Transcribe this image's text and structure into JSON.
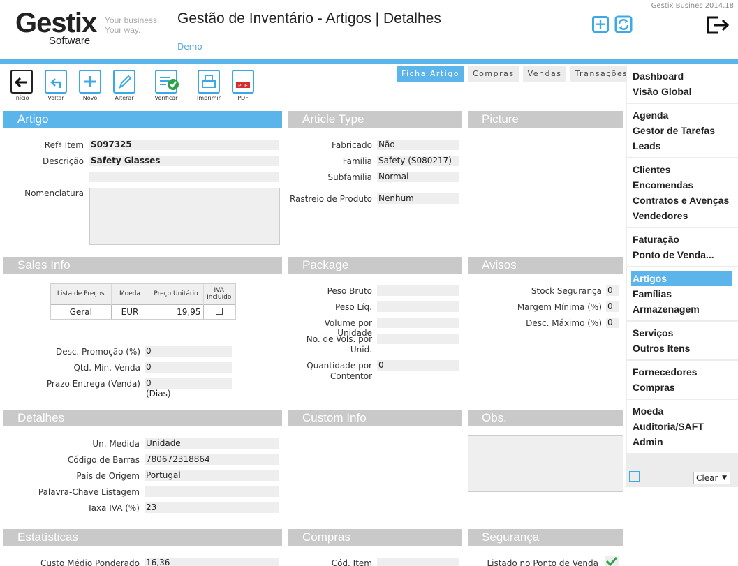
{
  "header": {
    "version": "Gestix Busines 2014.18",
    "logo_main": "Gestix",
    "logo_sub": "Software",
    "tagline_1": "Your business.",
    "tagline_2": "Your way.",
    "page_title": "Gestão de Inventário - Artigos | Detalhes",
    "company": "Demo"
  },
  "toolbar": {
    "inicio": "Início",
    "voltar": "Voltar",
    "novo": "Novo",
    "alterar": "Alterar",
    "verificar": "Verificar",
    "imprimir": "Imprimir",
    "pdf": "PDF"
  },
  "tabs": [
    "Ficha Artigo",
    "Compras",
    "Vendas",
    "Transações"
  ],
  "artigo": {
    "title": "Artigo",
    "ref_label": "Refª Item",
    "ref_value": "S097325",
    "desc_label": "Descrição",
    "desc_value": "Safety Glasses",
    "nomenclatura_label": "Nomenclatura"
  },
  "article_type": {
    "title": "Article Type",
    "fabricado_label": "Fabricado",
    "fabricado_value": "Não",
    "familia_label": "Família",
    "familia_value": "Safety (S080217)",
    "subfamilia_label": "Subfamília",
    "subfamilia_value": "Normal",
    "rastreio_label": "Rastreio de Produto",
    "rastreio_value": "Nenhum"
  },
  "picture": {
    "title": "Picture"
  },
  "sales_info": {
    "title": "Sales Info",
    "table_headers": [
      "Lista de Preços",
      "Moeda",
      "Preço Unitário",
      "IVA Incluído"
    ],
    "rows": [
      {
        "lista": "Geral",
        "moeda": "EUR",
        "preco": "19,95"
      }
    ],
    "desc_promo_label": "Desc. Promoção (%)",
    "desc_promo_value": "0",
    "qtd_min_label": "Qtd. Mín. Venda",
    "qtd_min_value": "0",
    "prazo_label": "Prazo Entrega (Venda)",
    "prazo_value": "0",
    "prazo_unit": "(Dias)"
  },
  "package": {
    "title": "Package",
    "peso_bruto_label": "Peso Bruto",
    "peso_liq_label": "Peso Líq.",
    "volume_label": "Volume por Unidade",
    "vols_label_1": "No. de Vols. por",
    "vols_label_2": "Unid.",
    "qtd_contentor_label_1": "Quantidade por",
    "qtd_contentor_label_2": "Contentor",
    "qtd_contentor_value": "0"
  },
  "avisos": {
    "title": "Avisos",
    "stock_label": "Stock Segurança",
    "stock_value": "0",
    "margem_label": "Margem Mínima (%)",
    "margem_value": "0",
    "desc_max_label": "Desc. Máximo (%)",
    "desc_max_value": "0"
  },
  "detalhes": {
    "title": "Detalhes",
    "un_medida_label": "Un. Medida",
    "un_medida_value": "Unidade",
    "barras_label": "Código de Barras",
    "barras_value": "780672318864",
    "pais_label": "País de Origem",
    "pais_value": "Portugal",
    "palavra_label": "Palavra-Chave Listagem",
    "taxa_label": "Taxa IVA (%)",
    "taxa_value": "23"
  },
  "custom_info": {
    "title": "Custom Info"
  },
  "obs": {
    "title": "Obs."
  },
  "estatisticas": {
    "title": "Estatísticas",
    "custo_label": "Custo Médio Ponderado",
    "custo_value": "16,36"
  },
  "compras": {
    "title": "Compras",
    "cod_item_label": "Cód. Item"
  },
  "seguranca": {
    "title": "Segurança",
    "listado_label": "Listado no Ponto de Venda"
  },
  "sidebar": {
    "groups": [
      [
        "Dashboard",
        "Visão Global"
      ],
      [
        "Agenda",
        "Gestor de Tarefas",
        "Leads"
      ],
      [
        "Clientes",
        "Encomendas",
        "Contratos e Avenças",
        "Vendedores"
      ],
      [
        "Faturação",
        "Ponto de Venda..."
      ],
      [
        "Artigos",
        "Famílias",
        "Armazenagem"
      ],
      [
        "Serviços",
        "Outros Itens"
      ],
      [
        "Fornecedores",
        "Compras"
      ],
      [
        "Moeda",
        "Auditoria/SAFT",
        "Admin"
      ]
    ],
    "active": "Artigos",
    "clear_label": "Clear"
  },
  "colors": {
    "accent": "#5bb4ea",
    "panel_gray": "#c9c9c9",
    "field_bg": "#eeeeee"
  }
}
